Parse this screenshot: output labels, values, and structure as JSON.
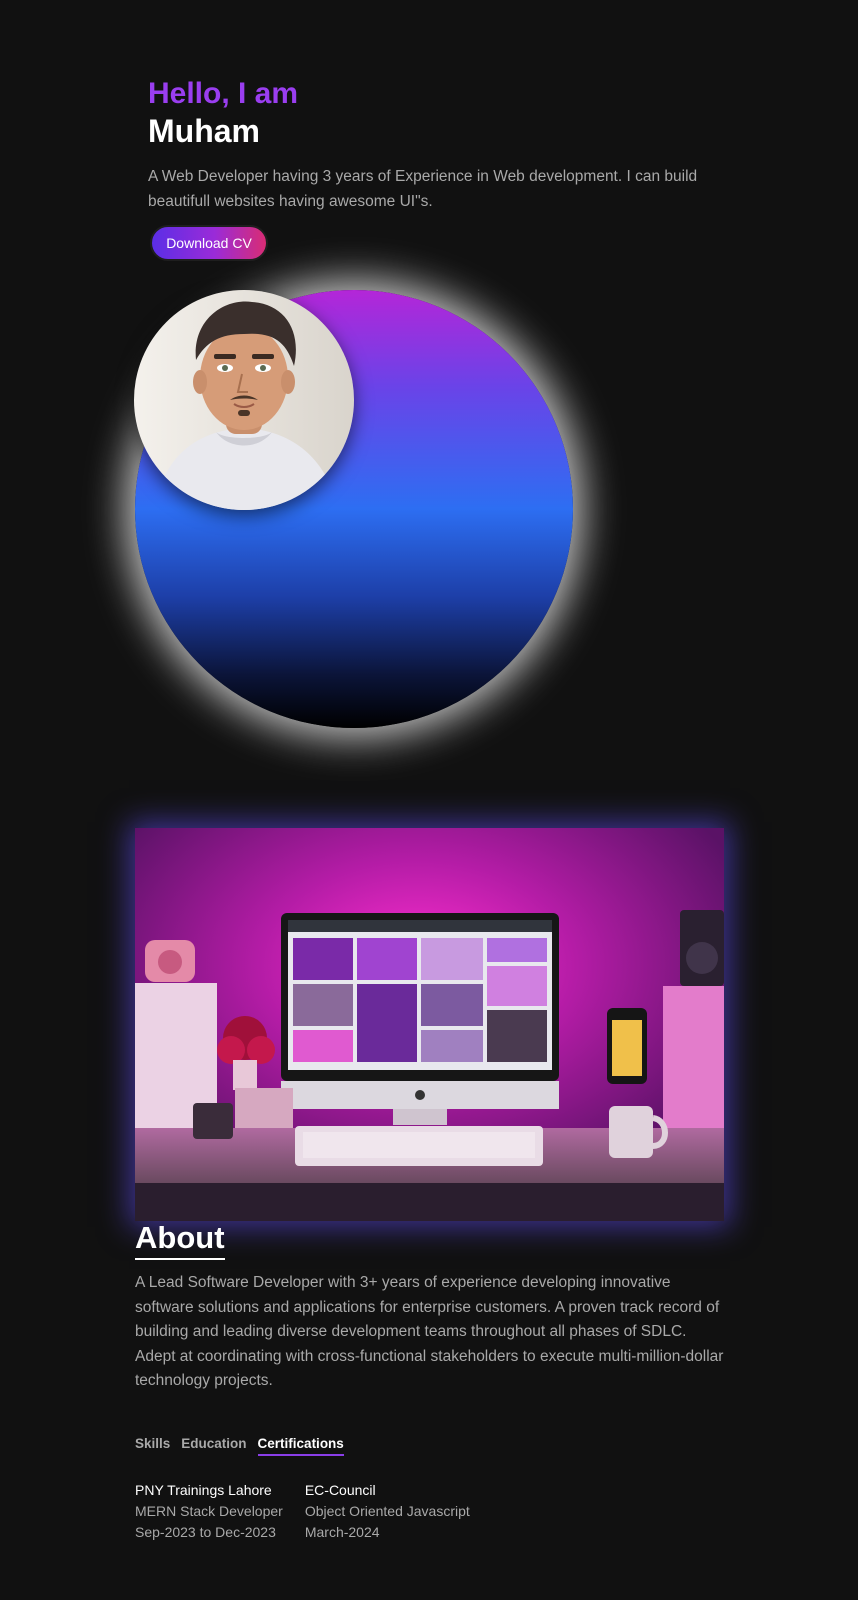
{
  "hero": {
    "greeting": "Hello, I am",
    "name": "Muham",
    "intro": "A Web Developer having 3 years of Experience in Web development. I can build beautifull websites having awesome UI\"s.",
    "cv_button": "Download CV"
  },
  "about": {
    "title": "About",
    "text": "A Lead Software Developer with 3+ years of experience developing innovative software solutions and applications for enterprise customers. A proven track record of building and leading diverse development teams throughout all phases of SDLC. Adept at coordinating with cross-functional stakeholders to execute multi-million-dollar technology projects."
  },
  "tabs": [
    {
      "label": "Skills",
      "active": false
    },
    {
      "label": "Education",
      "active": false
    },
    {
      "label": "Certifications",
      "active": true
    }
  ],
  "certifications": [
    {
      "org": "PNY Trainings Lahore",
      "course": "MERN Stack Developer",
      "date": "Sep-2023 to Dec-2023"
    },
    {
      "org": "EC-Council",
      "course": "Object Oriented Javascript",
      "date": "March-2024"
    }
  ],
  "colors": {
    "background": "#111111",
    "accent_purple": "#9a3ef0",
    "muted_text": "#a9a9a9"
  }
}
